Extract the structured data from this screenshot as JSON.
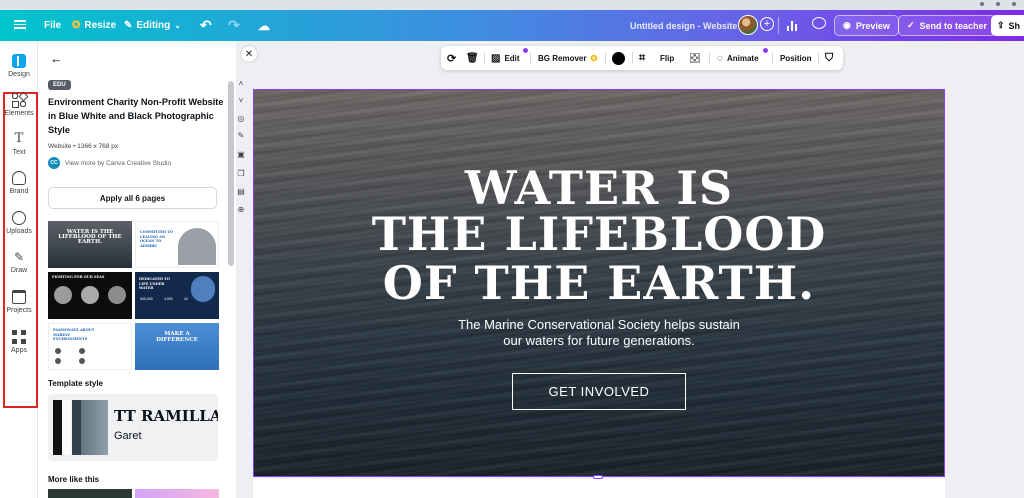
{
  "topbar": {
    "file": "File",
    "resize": "Resize",
    "editing": "Editing",
    "doc_title": "Untitled design - Website",
    "preview": "Preview",
    "send_to_teacher": "Send to teacher",
    "share": "Sh"
  },
  "rail": {
    "items": [
      {
        "label": "Design",
        "icon": "design-icon"
      },
      {
        "label": "Elements",
        "icon": "elements-icon"
      },
      {
        "label": "Text",
        "icon": "text-icon"
      },
      {
        "label": "Brand",
        "icon": "brand-icon"
      },
      {
        "label": "Uploads",
        "icon": "uploads-icon"
      },
      {
        "label": "Draw",
        "icon": "draw-icon"
      },
      {
        "label": "Projects",
        "icon": "projects-icon"
      },
      {
        "label": "Apps",
        "icon": "apps-icon"
      }
    ]
  },
  "panel": {
    "badge": "EDU",
    "template_title": "Environment Charity Non-Profit Website in Blue White and Black Photographic Style",
    "meta": "Website • 1366 x 768 px",
    "creator_initials": "CC",
    "creator_link": "View more by Canva Creative Studio",
    "apply_button": "Apply all 6 pages",
    "thumbnails": [
      {
        "title": "WATER IS THE LIFEBLOOD OF THE EARTH."
      },
      {
        "title": "COMMITTED TO LEAVING AN OCEAN TO ADMIRE"
      },
      {
        "title": "FIGHTING FOR OUR SEAS"
      },
      {
        "title": "DEDICATED TO LIFE UNDER WATER"
      },
      {
        "title": "PASSIONATE ABOUT MARINE ENVIRONMENTS"
      },
      {
        "title": "MAKE A DIFFERENCE"
      }
    ],
    "thumb_stats": [
      "540,000",
      "4,000",
      "42"
    ],
    "template_style_heading": "Template style",
    "style_heading_font": "TT RAMILLAS",
    "style_body_font": "Garet",
    "more_like_this": "More like this"
  },
  "toolbar": {
    "edit": "Edit",
    "bg_remover": "BG Remover",
    "flip": "Flip",
    "animate": "Animate",
    "position": "Position"
  },
  "hero": {
    "headline_line1": "WATER IS",
    "headline_line2": "THE LIFEBLOOD",
    "headline_line3": "OF THE EARTH.",
    "subtitle_line1": "The Marine Conservational Society helps sustain",
    "subtitle_line2": "our waters for future generations.",
    "cta": "GET INVOLVED"
  },
  "colors": {
    "accent_purple": "#8b3dff",
    "highlight_red": "#e02424",
    "gradient_start": "#00c4cc",
    "gradient_end": "#7d2ae8"
  }
}
